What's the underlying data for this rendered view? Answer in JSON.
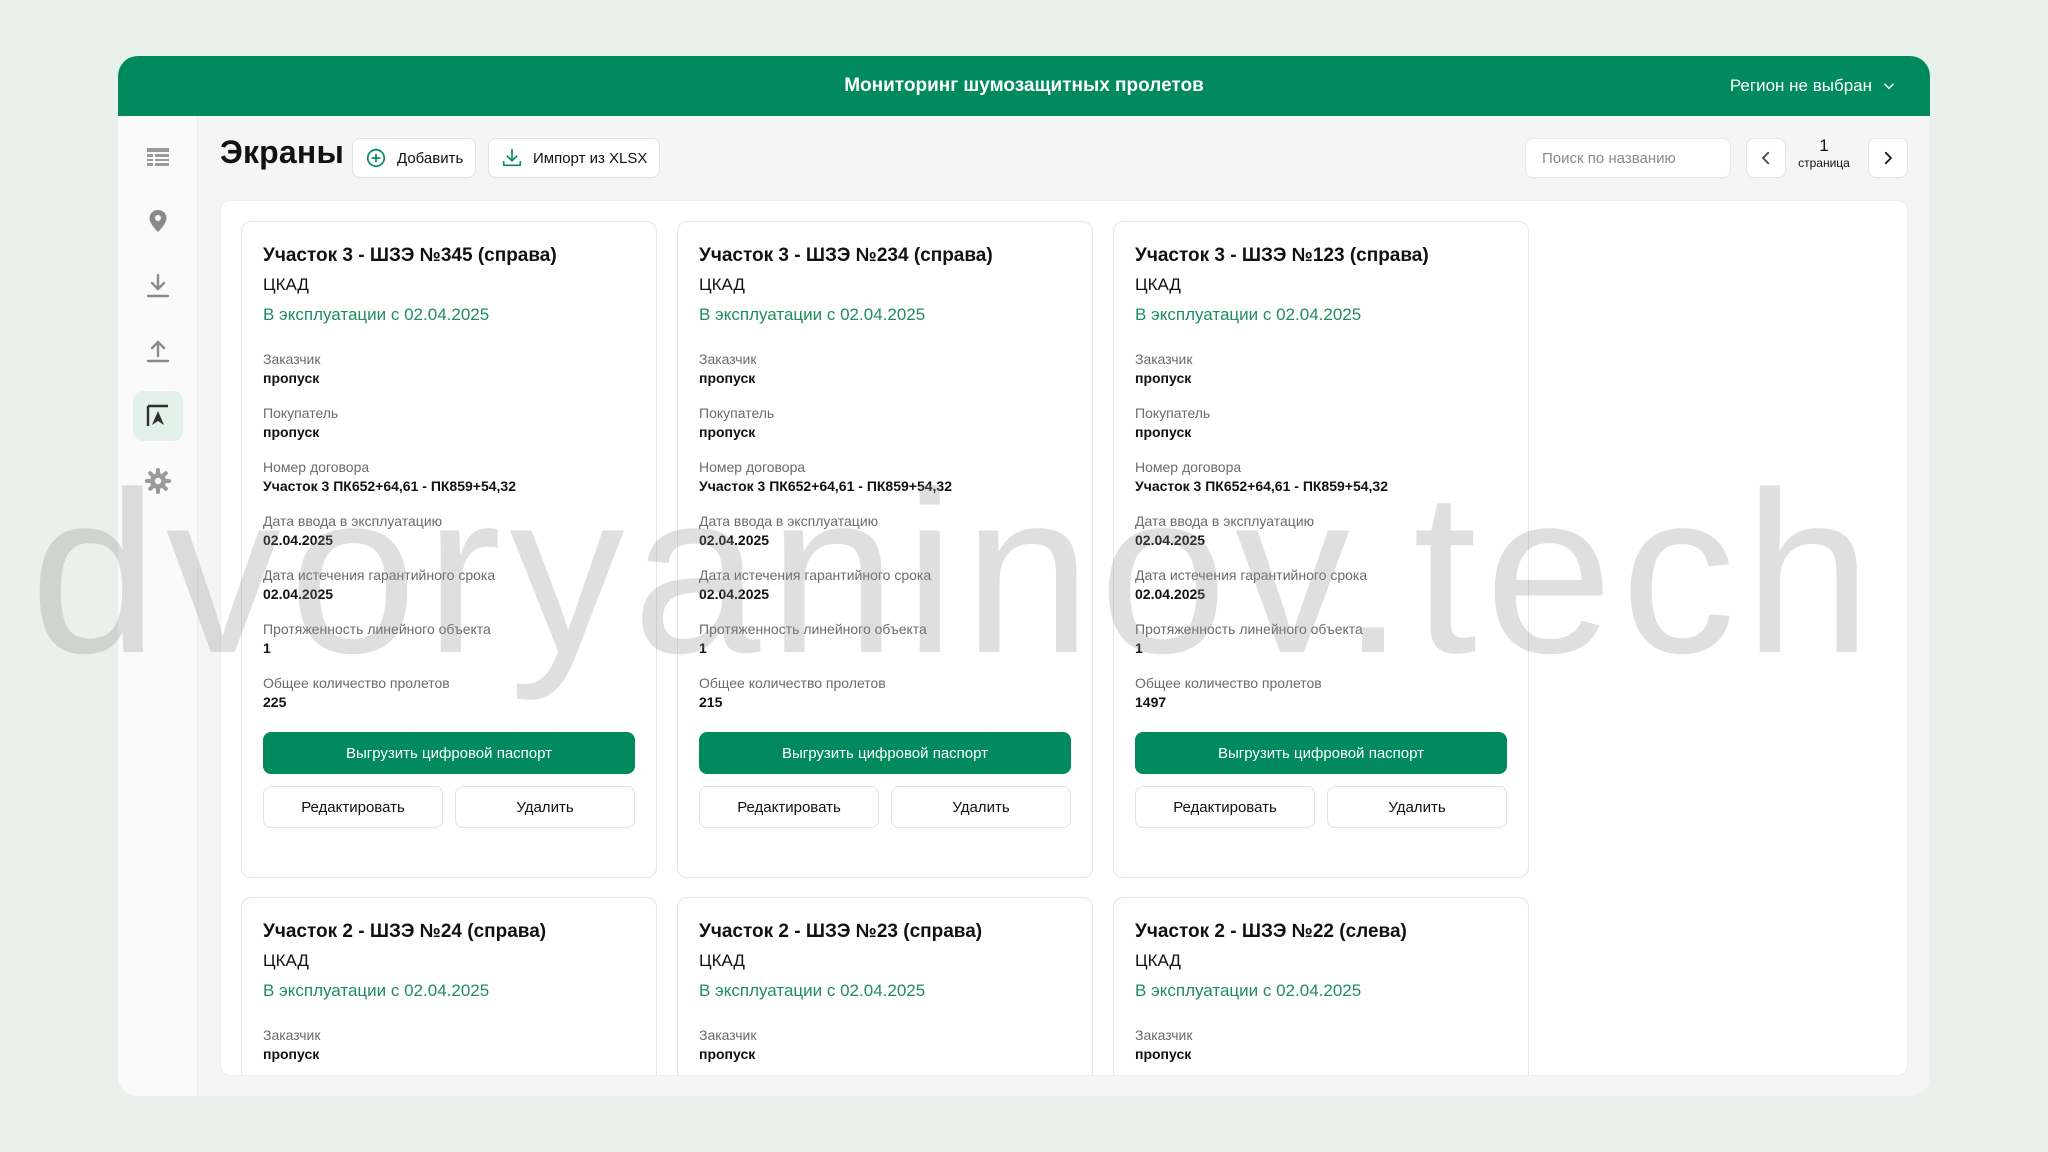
{
  "app": {
    "title": "Мониторинг шумозащитных пролетов",
    "region_label": "Регион не выбран"
  },
  "sidebar": {
    "items": [
      {
        "icon": "table-icon"
      },
      {
        "icon": "map-pin-icon"
      },
      {
        "icon": "download-icon"
      },
      {
        "icon": "upload-icon"
      },
      {
        "icon": "screens-icon",
        "active": true
      },
      {
        "icon": "gear-icon"
      }
    ]
  },
  "header": {
    "page_title": "Экраны",
    "add_label": "Добавить",
    "import_label": "Импорт из XLSX",
    "search_placeholder": "Поиск по названию",
    "page_number": "1",
    "page_label": "страница"
  },
  "card_labels": {
    "customer": "Заказчик",
    "buyer": "Покупатель",
    "contract": "Номер договора",
    "commission_date": "Дата ввода в эксплуатацию",
    "warranty_date": "Дата истечения гарантийного срока",
    "length": "Протяженность линейного объекта",
    "spans": "Общее количество пролетов",
    "export": "Выгрузить цифровой паспорт",
    "edit": "Редактировать",
    "delete": "Удалить"
  },
  "cards": [
    {
      "title": "Участок 3 - ШЗЭ №345 (справа)",
      "road": "ЦКАД",
      "status": "В эксплуатации с 02.04.2025",
      "customer": "пропуск",
      "buyer": "пропуск",
      "contract": "Участок 3 ПК652+64,61 - ПК859+54,32",
      "commission_date": "02.04.2025",
      "warranty_date": "02.04.2025",
      "length": "1",
      "spans": "225"
    },
    {
      "title": "Участок 3 - ШЗЭ №234 (справа)",
      "road": "ЦКАД",
      "status": "В эксплуатации с 02.04.2025",
      "customer": "пропуск",
      "buyer": "пропуск",
      "contract": "Участок 3 ПК652+64,61 - ПК859+54,32",
      "commission_date": "02.04.2025",
      "warranty_date": "02.04.2025",
      "length": "1",
      "spans": "215"
    },
    {
      "title": "Участок 3 - ШЗЭ №123 (справа)",
      "road": "ЦКАД",
      "status": "В эксплуатации с 02.04.2025",
      "customer": "пропуск",
      "buyer": "пропуск",
      "contract": "Участок 3 ПК652+64,61 - ПК859+54,32",
      "commission_date": "02.04.2025",
      "warranty_date": "02.04.2025",
      "length": "1",
      "spans": "1497"
    },
    {
      "title": "Участок 2 - ШЗЭ №24 (справа)",
      "road": "ЦКАД",
      "status": "В эксплуатации с 02.04.2025",
      "customer": "пропуск"
    },
    {
      "title": "Участок 2 - ШЗЭ №23 (справа)",
      "road": "ЦКАД",
      "status": "В эксплуатации с 02.04.2025",
      "customer": "пропуск"
    },
    {
      "title": "Участок 2 - ШЗЭ №22 (слева)",
      "road": "ЦКАД",
      "status": "В эксплуатации с 02.04.2025",
      "customer": "пропуск"
    }
  ],
  "watermark": "dvoryaninov.tech",
  "colors": {
    "brand": "#008a5e",
    "status_text": "#1f8c5f",
    "page_background": "#e8f1ec"
  }
}
